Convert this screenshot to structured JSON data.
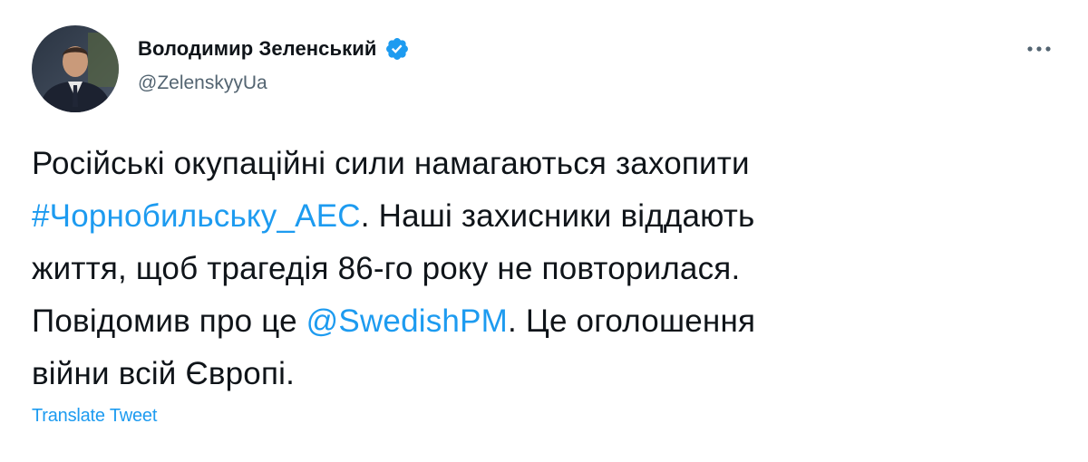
{
  "author": {
    "display_name": "Володимир Зеленський",
    "handle": "@ZelenskyyUa",
    "verified": true,
    "avatar_icon": "profile-photo"
  },
  "menu": {
    "more_icon": "more-horizontal-icon"
  },
  "tweet": {
    "lines": [
      {
        "segments": [
          {
            "text": "Російські окупаційні сили намагаються захопити",
            "type": "text"
          }
        ]
      },
      {
        "segments": [
          {
            "text": "#Чорнобильську_АЕС",
            "type": "hashtag"
          },
          {
            "text": ". Наші захисники віддають",
            "type": "text"
          }
        ]
      },
      {
        "segments": [
          {
            "text": "життя, щоб трагедія 86-го року не повторилася.",
            "type": "text"
          }
        ]
      },
      {
        "segments": [
          {
            "text": "Повідомив про це ",
            "type": "text"
          },
          {
            "text": "@SwedishPM",
            "type": "mention"
          },
          {
            "text": ". Це оголошення",
            "type": "text"
          }
        ]
      },
      {
        "segments": [
          {
            "text": "війни всій Європі.",
            "type": "text"
          }
        ]
      }
    ]
  },
  "actions": {
    "translate_label": "Translate Tweet"
  },
  "colors": {
    "link": "#1d9bf0",
    "text": "#0f1419",
    "secondary": "#536471"
  }
}
